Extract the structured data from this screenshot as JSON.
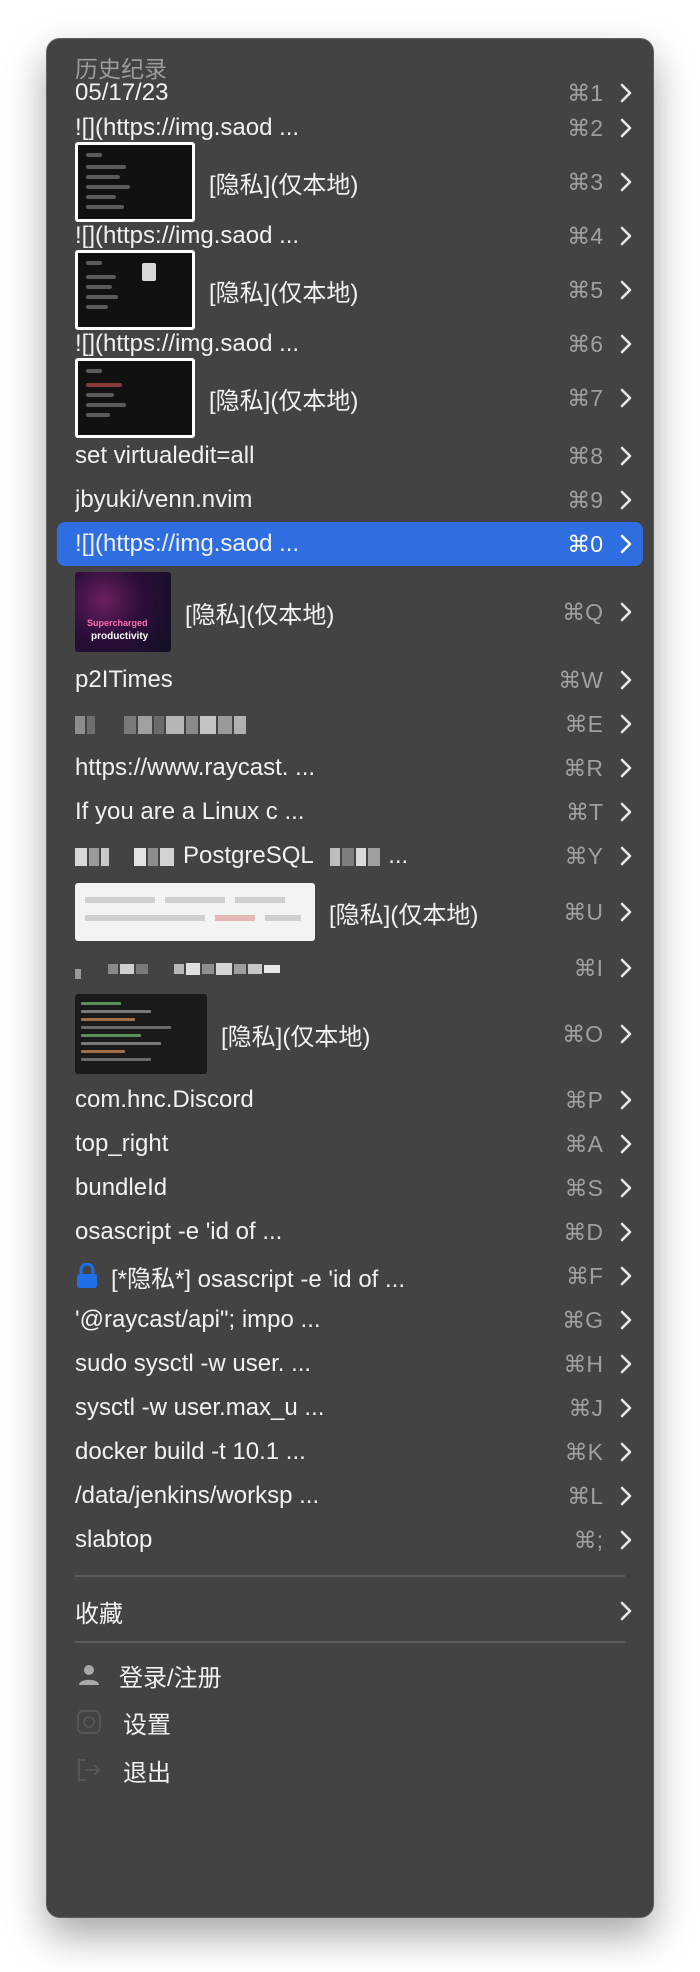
{
  "menu": {
    "history_title": "历史纪录",
    "items": [
      {
        "label": "05/17/23",
        "shortcut": "⌘1"
      },
      {
        "label": "![](https://img.saod ...",
        "shortcut": "⌘2"
      },
      {
        "label": "[隐私](仅本地)",
        "shortcut": "⌘3",
        "thumbnail": "dark-app-screenshot"
      },
      {
        "label": "![](https://img.saod ...",
        "shortcut": "⌘4"
      },
      {
        "label": "[隐私](仅本地)",
        "shortcut": "⌘5",
        "thumbnail": "dark-app-screenshot"
      },
      {
        "label": "![](https://img.saod ...",
        "shortcut": "⌘6"
      },
      {
        "label": "[隐私](仅本地)",
        "shortcut": "⌘7",
        "thumbnail": "dark-app-screenshot"
      },
      {
        "label": "set virtualedit=all",
        "shortcut": "⌘8"
      },
      {
        "label": "jbyuki/venn.nvim",
        "shortcut": "⌘9"
      },
      {
        "label": "![](https://img.saod ...",
        "shortcut": "⌘0",
        "selected": true
      },
      {
        "label": "[隐私](仅本地)",
        "shortcut": "⌘Q",
        "thumbnail": "purple-productivity"
      },
      {
        "label": "p2ITimes",
        "shortcut": "⌘W"
      },
      {
        "label": "",
        "shortcut": "⌘E",
        "pixelated": true
      },
      {
        "label": "https://www.raycast. ...",
        "shortcut": "⌘R"
      },
      {
        "label": "If you are a Linux c ...",
        "shortcut": "⌘T"
      },
      {
        "label": "PostgreSQL",
        "suffix": "...",
        "shortcut": "⌘Y",
        "pixelated": true
      },
      {
        "label": "[隐私](仅本地)",
        "shortcut": "⌘U",
        "thumbnail": "white-wide"
      },
      {
        "label": "",
        "shortcut": "⌘I",
        "pixelated": true
      },
      {
        "label": "[隐私](仅本地)",
        "shortcut": "⌘O",
        "thumbnail": "code-editor"
      },
      {
        "label": "com.hnc.Discord",
        "shortcut": "⌘P"
      },
      {
        "label": "top_right",
        "shortcut": "⌘A"
      },
      {
        "label": "bundleId",
        "shortcut": "⌘S"
      },
      {
        "label": "osascript -e 'id of ...",
        "shortcut": "⌘D"
      },
      {
        "label": "[*隐私*] osascript -e 'id of ...",
        "shortcut": "⌘F",
        "icon": "lock-icon"
      },
      {
        "label": "'@raycast/api\"; impo ...",
        "shortcut": "⌘G"
      },
      {
        "label": "sudo sysctl -w user. ...",
        "shortcut": "⌘H"
      },
      {
        "label": "sysctl -w user.max_u ...",
        "shortcut": "⌘J"
      },
      {
        "label": "docker build -t 10.1 ...",
        "shortcut": "⌘K"
      },
      {
        "label": "/data/jenkins/worksp ...",
        "shortcut": "⌘L"
      },
      {
        "label": "slabtop",
        "shortcut": "⌘;"
      }
    ],
    "favorites_label": "收藏",
    "footer": {
      "login_label": "登录/注册",
      "settings_label": "设置",
      "quit_label": "退出"
    },
    "colors": {
      "background": "#434343",
      "selected": "#2f6ee0",
      "text": "#f1f1f1",
      "muted": "#9f9f9f",
      "lock": "#1f6fe8"
    }
  }
}
